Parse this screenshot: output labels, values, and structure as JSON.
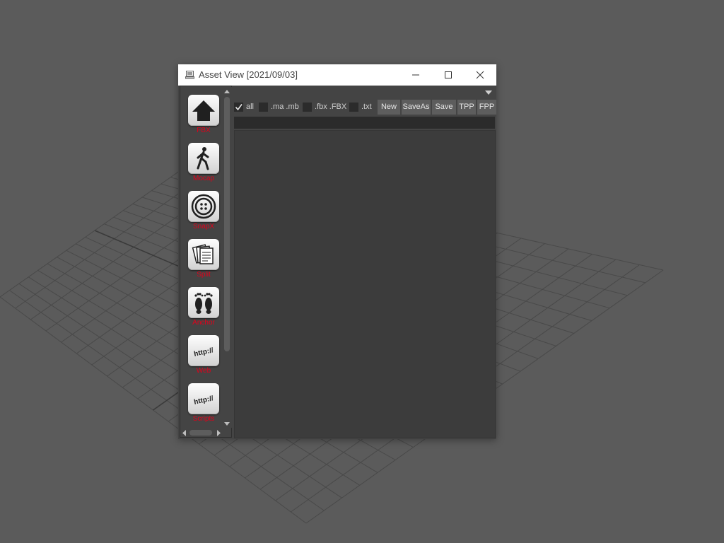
{
  "window": {
    "title": "Asset View [2021/09/03]"
  },
  "sidebar": {
    "tools": [
      {
        "label": "FBX",
        "icon": "home-arrow-icon"
      },
      {
        "label": "Mocap",
        "icon": "walking-person-icon"
      },
      {
        "label": "SnapX",
        "icon": "button-icon"
      },
      {
        "label": "Split",
        "icon": "documents-icon"
      },
      {
        "label": "Anchor",
        "icon": "footprints-icon"
      },
      {
        "label": "Web",
        "icon": "http-icon"
      },
      {
        "label": "Scripts",
        "icon": "http-icon"
      }
    ],
    "http_text": "http://"
  },
  "filters": [
    {
      "label": "all",
      "checked": true
    },
    {
      "label": ".ma .mb",
      "checked": false
    },
    {
      "label": ".fbx .FBX",
      "checked": false
    },
    {
      "label": ".txt",
      "checked": false
    }
  ],
  "actions": {
    "new": "New",
    "save_as": "SaveAs",
    "save": "Save",
    "tpp": "TPP",
    "fpp": "FPP"
  },
  "search": {
    "value": "",
    "placeholder": ""
  },
  "colors": {
    "viewport_bg": "#5b5b5b",
    "panel_bg": "#444444",
    "tool_label": "#e2001a",
    "button_bg": "#5d5d5d",
    "field_bg": "#2b2b2b"
  }
}
